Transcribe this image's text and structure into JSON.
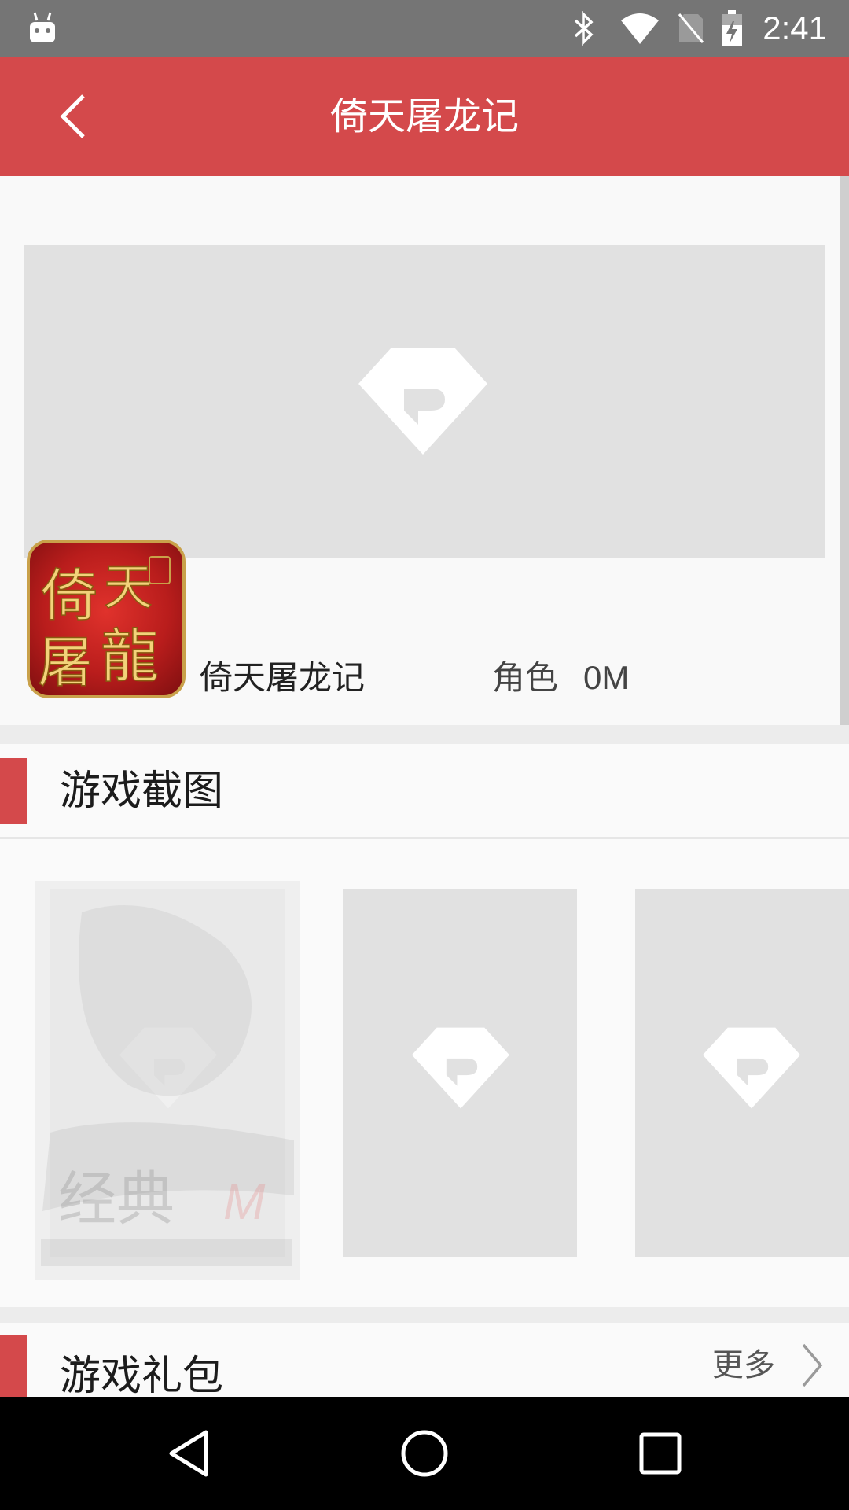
{
  "status_bar": {
    "time": "2:41",
    "icons": [
      "android-icon",
      "bluetooth-icon",
      "wifi-icon",
      "no-sim-icon",
      "battery-charging-icon"
    ]
  },
  "toolbar": {
    "title": "倚天屠龙记",
    "back_icon": "back-arrow-icon"
  },
  "game": {
    "name": "倚天屠龙记",
    "category": "角色",
    "size": "0M",
    "icon_text": "倚天屠龍"
  },
  "screenshots_section": {
    "title": "游戏截图",
    "watermark_text": "经典"
  },
  "gifts_section": {
    "title": "游戏礼包",
    "more_label": "更多"
  },
  "colors": {
    "accent": "#d4494b",
    "status_bar": "#757575",
    "placeholder": "#e1e1e1",
    "background": "#f9f9f9"
  }
}
